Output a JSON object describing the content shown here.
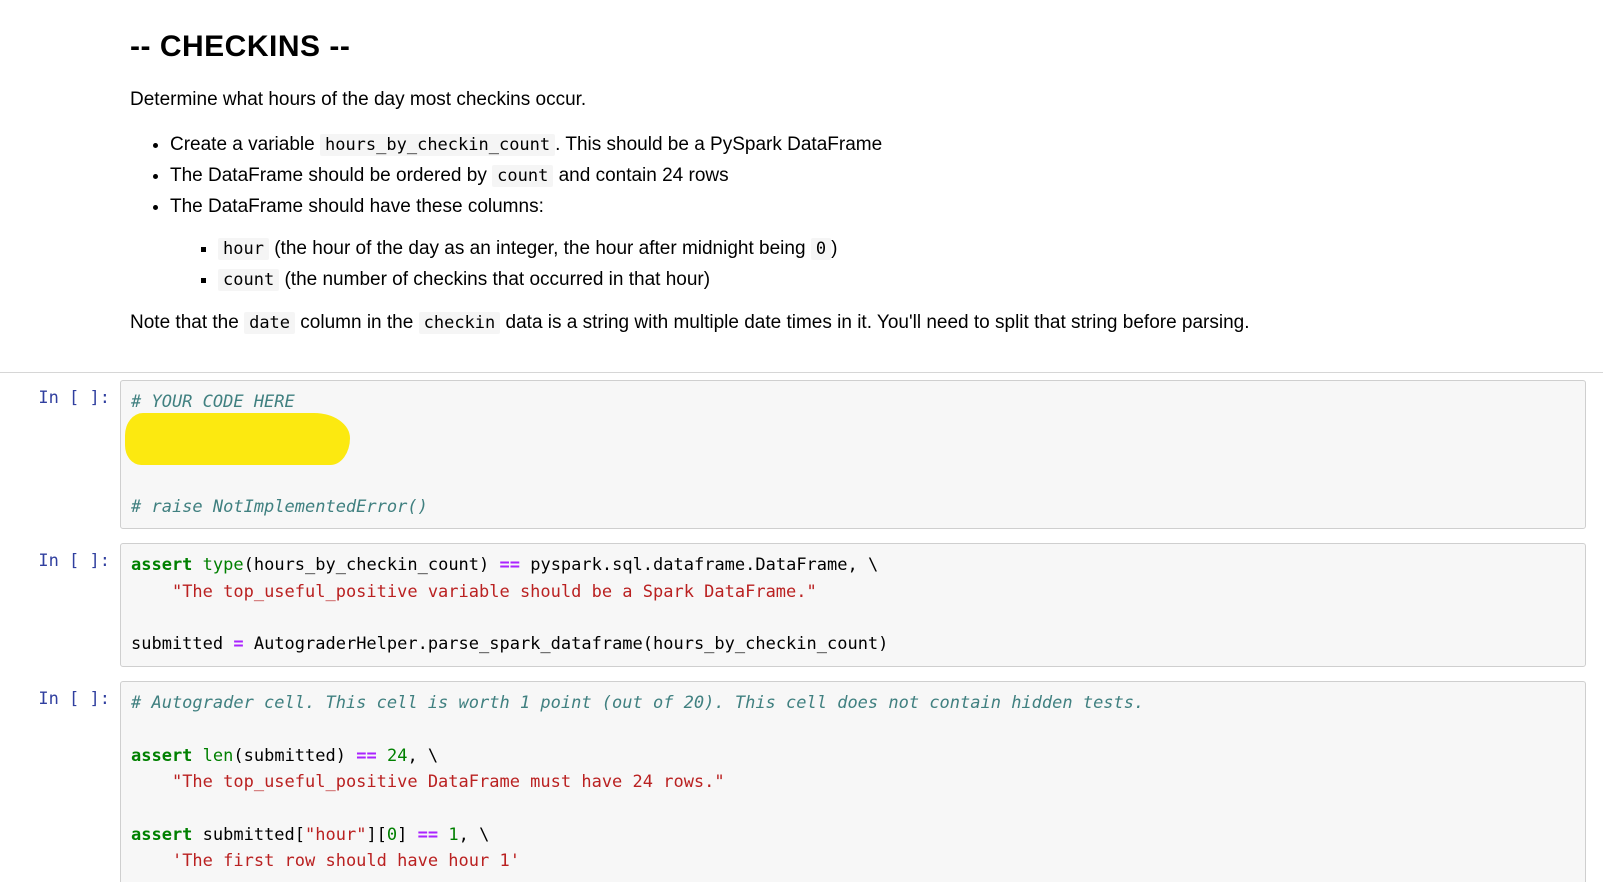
{
  "markdown": {
    "heading": "-- CHECKINS --",
    "intro": "Determine what hours of the day most checkins occur.",
    "bullet1_pre": "Create a variable ",
    "bullet1_code": "hours_by_checkin_count",
    "bullet1_post": ". This should be a PySpark DataFrame",
    "bullet2_pre": "The DataFrame should be ordered by ",
    "bullet2_code": "count",
    "bullet2_post": " and contain 24 rows",
    "bullet3": "The DataFrame should have these columns:",
    "sub1_code": "hour",
    "sub1_text": " (the hour of the day as an integer, the hour after midnight being ",
    "sub1_code2": "0",
    "sub1_post": ")",
    "sub2_code": "count",
    "sub2_text": " (the number of checkins that occurred in that hour)",
    "note_pre": "Note that the ",
    "note_code1": "date",
    "note_mid": " column in the ",
    "note_code2": "checkin",
    "note_post": " data is a string with multiple date times in it. You'll need to split that string before parsing."
  },
  "prompts": {
    "in_empty": "In [ ]:"
  },
  "cell1": {
    "line1": "# YOUR CODE HERE",
    "line2": "# raise NotImplementedError()"
  },
  "cell2": {
    "kw_assert": "assert",
    "bi_type": "type",
    "l1_text1": "(hours_by_checkin_count) ",
    "op_eq": "==",
    "l1_text2": " pyspark.sql.dataframe.DataFrame, \\",
    "l2_str": "\"The top_useful_positive variable should be a Spark DataFrame.\"",
    "l3_text1": "submitted ",
    "op_assign": "=",
    "l3_text2": " AutograderHelper.parse_spark_dataframe(hours_by_checkin_count)"
  },
  "cell3": {
    "comment": "# Autograder cell. This cell is worth 1 point (out of 20). This cell does not contain hidden tests.",
    "kw_assert": "assert",
    "bi_len": "len",
    "l2_text1": "(submitted) ",
    "op_eq": "==",
    "num24": "24",
    "l2_text2": ", \\",
    "l3_str": "\"The top_useful_positive DataFrame must have 24 rows.\"",
    "l4_text1": " submitted[",
    "l4_str1": "\"hour\"",
    "l4_text2": "][",
    "num0": "0",
    "l4_text3": "] ",
    "num1": "1",
    "l4_text4": ", \\",
    "l5_str": "'The first row should have hour 1'"
  }
}
